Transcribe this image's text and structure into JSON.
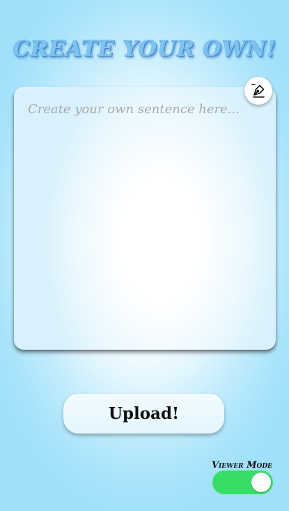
{
  "header": {
    "title": "CREATE YOUR OWN!"
  },
  "editor": {
    "placeholder": "Create your own sentence here...",
    "value": "",
    "edit_icon": "pen-edit-icon"
  },
  "actions": {
    "upload_label": "Upload!"
  },
  "viewer_mode": {
    "label": "Viewer Mode",
    "enabled": true,
    "on_color": "#38dd65"
  },
  "colors": {
    "title_fill": "#7ec3f0",
    "title_outline": "#2f78c8",
    "background_edge": "#9fe0fa",
    "background_center": "#ffffff"
  }
}
